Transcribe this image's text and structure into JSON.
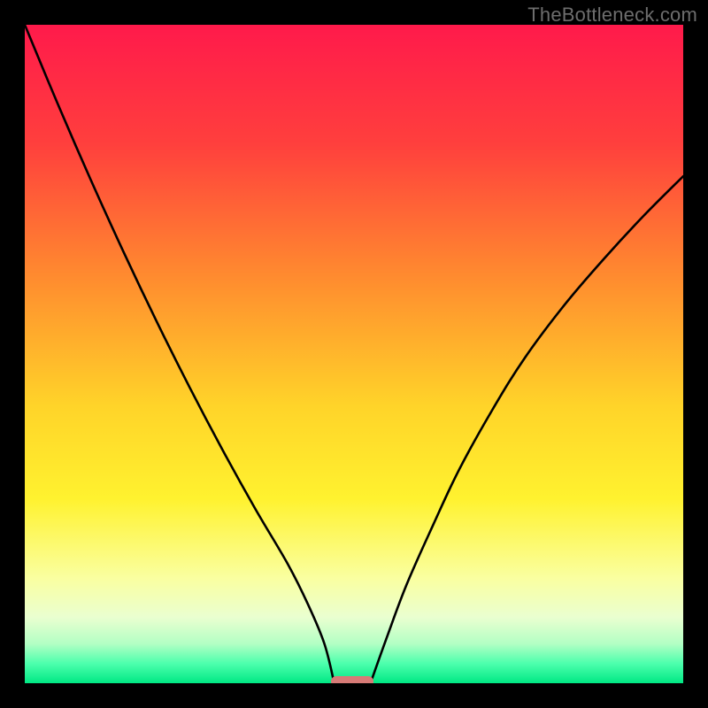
{
  "watermark": {
    "text": "TheBottleneck.com"
  },
  "chart_data": {
    "type": "line",
    "title": "",
    "xlabel": "",
    "ylabel": "",
    "xlim": [
      0,
      100
    ],
    "ylim": [
      0,
      100
    ],
    "grid": false,
    "legend": false,
    "gradient_stops": [
      {
        "pct": 0,
        "color": "#ff1a4b"
      },
      {
        "pct": 18,
        "color": "#ff3f3d"
      },
      {
        "pct": 38,
        "color": "#ff8a2f"
      },
      {
        "pct": 58,
        "color": "#ffd429"
      },
      {
        "pct": 72,
        "color": "#fff22f"
      },
      {
        "pct": 84,
        "color": "#faffa0"
      },
      {
        "pct": 90,
        "color": "#eaffd0"
      },
      {
        "pct": 94,
        "color": "#b3ffc4"
      },
      {
        "pct": 97,
        "color": "#4dffad"
      },
      {
        "pct": 100,
        "color": "#00e884"
      }
    ],
    "series": [
      {
        "name": "left-curve",
        "x": [
          0.0,
          5.0,
          10.0,
          15.0,
          20.0,
          25.0,
          30.0,
          35.0,
          40.0,
          43.0,
          45.5,
          47.0
        ],
        "y": [
          100.0,
          88.0,
          76.5,
          65.5,
          55.0,
          45.0,
          35.5,
          26.5,
          18.0,
          12.0,
          6.0,
          0.0
        ]
      },
      {
        "name": "right-curve",
        "x": [
          52.5,
          55.0,
          58.0,
          62.0,
          66.0,
          71.0,
          76.0,
          82.0,
          88.0,
          94.0,
          100.0
        ],
        "y": [
          0.0,
          7.0,
          15.0,
          24.0,
          32.5,
          41.5,
          49.5,
          57.5,
          64.5,
          71.0,
          77.0
        ]
      }
    ],
    "marker": {
      "x_start": 46.5,
      "x_end": 53.0,
      "y": 0.0,
      "color": "#d77b77"
    }
  }
}
